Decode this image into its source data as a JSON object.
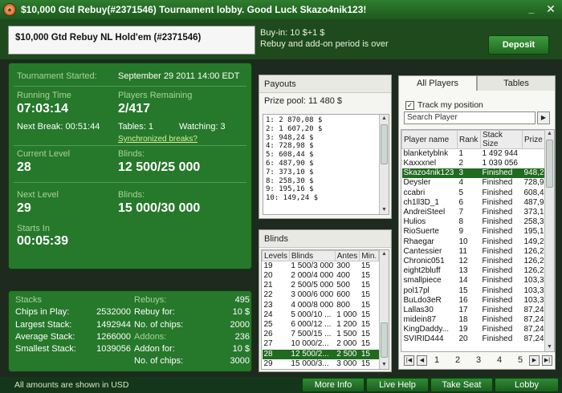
{
  "window": {
    "title": "$10,000 Gtd Rebuy(#2371546) Tournament lobby. Good Luck Skazo4nik123!",
    "minimize": "_",
    "close": "✕"
  },
  "header": {
    "tournament_name": "$10,000 Gtd Rebuy NL Hold'em (#2371546)",
    "buyin": "Buy-in: 10 $+1 $",
    "rebuy_status": "Rebuy and add-on period is over",
    "deposit_label": "Deposit"
  },
  "info": {
    "started_label": "Tournament Started:",
    "started_value": "September 29 2011   14:00 EDT",
    "running_label": "Running Time",
    "running_value": "07:03:14",
    "players_label": "Players Remaining",
    "players_value": "2/417",
    "next_break": "Next Break: 00:51:44",
    "tables": "Tables: 1",
    "watching": "Watching: 3",
    "sync_link": "Synchronized breaks?",
    "current_level_label": "Current Level",
    "current_level_value": "28",
    "blinds_label": "Blinds:",
    "current_blinds": "12 500/25 000",
    "next_level_label": "Next Level",
    "next_level_value": "29",
    "next_blinds": "15 000/30 000",
    "starts_in_label": "Starts In",
    "starts_in_value": "00:05:39"
  },
  "stats": {
    "left": [
      {
        "k": "Stacks",
        "v": "",
        "hd": true
      },
      {
        "k": "Chips in Play:",
        "v": "2532000"
      },
      {
        "k": "Largest Stack:",
        "v": "1492944"
      },
      {
        "k": "Average Stack:",
        "v": "1266000"
      },
      {
        "k": "Smallest Stack:",
        "v": "1039056"
      }
    ],
    "right": [
      {
        "k": "Rebuys:",
        "v": "495",
        "hd": true
      },
      {
        "k": "Rebuy for:",
        "v": "10 $"
      },
      {
        "k": "No. of chips:",
        "v": "2000"
      },
      {
        "k": "Addons:",
        "v": "236",
        "hd": true
      },
      {
        "k": "Addon for:",
        "v": "10 $"
      },
      {
        "k": "No. of chips:",
        "v": "3000"
      }
    ]
  },
  "payouts": {
    "title": "Payouts",
    "prize_pool": "Prize pool: 11 480 $",
    "items": [
      "1: 2 870,08 $",
      "2: 1 607,20 $",
      "3: 948,24 $",
      "4: 728,98 $",
      "5: 608,44 $",
      "6: 487,90 $",
      "7: 373,10 $",
      "8: 258,30 $",
      "9: 195,16 $",
      "10: 149,24 $"
    ]
  },
  "blinds": {
    "title": "Blinds",
    "headers": [
      "Levels",
      "Blinds",
      "Antes",
      "Min."
    ],
    "rows": [
      [
        "19",
        "1 500/3 000",
        "300",
        "15"
      ],
      [
        "20",
        "2 000/4 000",
        "400",
        "15"
      ],
      [
        "21",
        "2 500/5 000",
        "500",
        "15"
      ],
      [
        "22",
        "3 000/6 000",
        "600",
        "15"
      ],
      [
        "23",
        "4 000/8 000",
        "800",
        "15"
      ],
      [
        "24",
        "5 000/10 ...",
        "1 000",
        "15"
      ],
      [
        "25",
        "6 000/12 ...",
        "1 200",
        "15"
      ],
      [
        "26",
        "7 500/15 ...",
        "1 500",
        "15"
      ],
      [
        "27",
        "10 000/2...",
        "2 000",
        "15"
      ],
      [
        "28",
        "12 500/2...",
        "2 500",
        "15"
      ],
      [
        "29",
        "15 000/3...",
        "3 000",
        "15"
      ]
    ],
    "selected_index": 9
  },
  "players": {
    "tab_all": "All Players",
    "tab_tables": "Tables",
    "track_label": "Track my position",
    "search_placeholder": "Search Player",
    "headers": [
      "Player name",
      "Rank",
      "Stack Size",
      "Prize"
    ],
    "rows": [
      [
        "blanketyblnk",
        "1",
        "1 492 944",
        ""
      ],
      [
        "Kaxxxnel",
        "2",
        "1 039 056",
        ""
      ],
      [
        "Skazo4nik123",
        "3",
        "Finished",
        "948,2..."
      ],
      [
        "Deysler",
        "4",
        "Finished",
        "728,9..."
      ],
      [
        "ccabri",
        "5",
        "Finished",
        "608,4..."
      ],
      [
        "ch1ll3D_1",
        "6",
        "Finished",
        "487,9..."
      ],
      [
        "AndreiSteel",
        "7",
        "Finished",
        "373,1..."
      ],
      [
        "Hulios",
        "8",
        "Finished",
        "258,3..."
      ],
      [
        "RioSuerte",
        "9",
        "Finished",
        "195,1..."
      ],
      [
        "Rhaegar",
        "10",
        "Finished",
        "149,2..."
      ],
      [
        "Cantessier",
        "11",
        "Finished",
        "126,2..."
      ],
      [
        "Chronic051",
        "12",
        "Finished",
        "126,2..."
      ],
      [
        "eight2bluff",
        "13",
        "Finished",
        "126,2..."
      ],
      [
        "smallpiece",
        "14",
        "Finished",
        "103,3..."
      ],
      [
        "pol17pl",
        "15",
        "Finished",
        "103,3..."
      ],
      [
        "BuLdo3eR",
        "16",
        "Finished",
        "103,3..."
      ],
      [
        "Lallas30",
        "17",
        "Finished",
        "87,24 $"
      ],
      [
        "midein87",
        "18",
        "Finished",
        "87,24 $"
      ],
      [
        "KingDaddy...",
        "19",
        "Finished",
        "87,24 $"
      ],
      [
        "SVIRID444",
        "20",
        "Finished",
        "87,24 $"
      ]
    ],
    "selected_index": 2,
    "pages": [
      "1",
      "2",
      "3",
      "4",
      "5"
    ]
  },
  "footer": {
    "currency_note": "All amounts are shown in USD",
    "more_info": "More Info",
    "live_help": "Live Help",
    "take_seat": "Take Seat",
    "lobby": "Lobby"
  }
}
